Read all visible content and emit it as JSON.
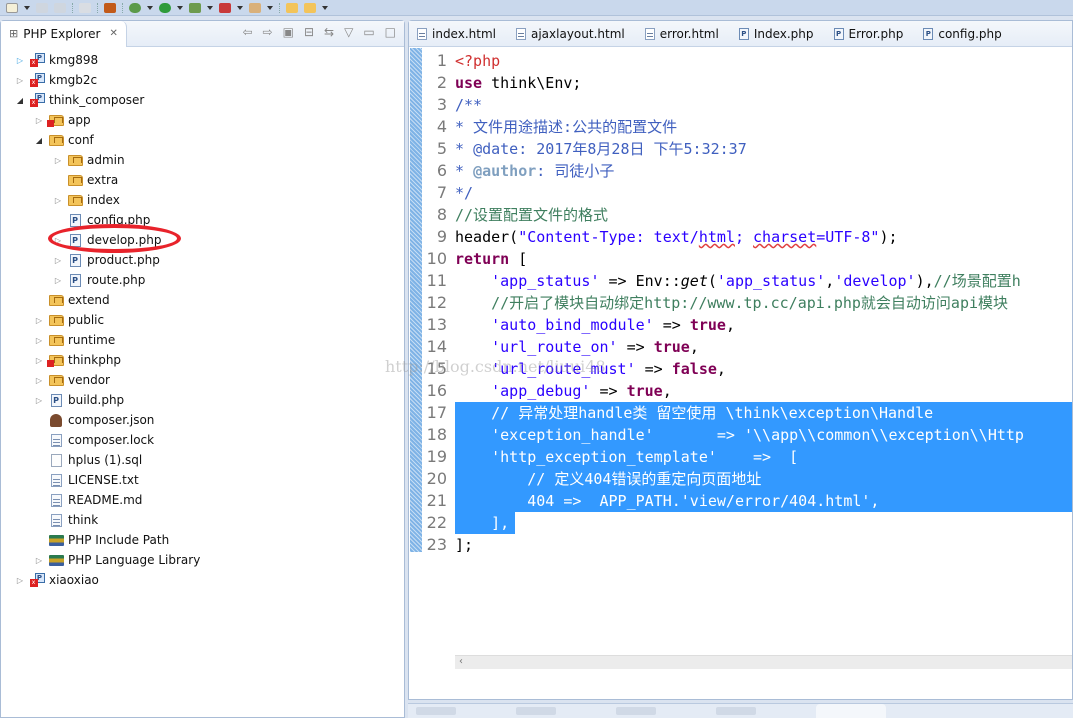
{
  "explorer": {
    "title": "PHP Explorer",
    "close_icon": "close-icon",
    "actions": [
      {
        "name": "back-icon",
        "glyph": "⇦"
      },
      {
        "name": "forward-icon",
        "glyph": "⇨"
      },
      {
        "name": "up-icon",
        "glyph": "▣"
      },
      {
        "name": "collapse-all-icon",
        "glyph": "⊟"
      },
      {
        "name": "link-with-editor-icon",
        "glyph": "⇆"
      },
      {
        "name": "view-menu-icon",
        "glyph": "▽"
      },
      {
        "name": "minimize-icon",
        "glyph": "▭"
      },
      {
        "name": "maximize-icon",
        "glyph": "□"
      }
    ],
    "tree": [
      {
        "label": "kmg898",
        "depth": 0,
        "icon": "project",
        "twisty": "collapsed-blue"
      },
      {
        "label": "kmgb2c",
        "depth": 0,
        "icon": "project",
        "twisty": "collapsed"
      },
      {
        "label": "think_composer",
        "depth": 0,
        "icon": "project",
        "twisty": "expanded"
      },
      {
        "label": "app",
        "depth": 1,
        "icon": "folder-error",
        "twisty": "collapsed"
      },
      {
        "label": "conf",
        "depth": 1,
        "icon": "folder",
        "twisty": "expanded"
      },
      {
        "label": "admin",
        "depth": 2,
        "icon": "folder",
        "twisty": "collapsed"
      },
      {
        "label": "extra",
        "depth": 2,
        "icon": "folder",
        "twisty": "none"
      },
      {
        "label": "index",
        "depth": 2,
        "icon": "folder",
        "twisty": "collapsed"
      },
      {
        "label": "config.php",
        "depth": 2,
        "icon": "php",
        "twisty": "none"
      },
      {
        "label": "develop.php",
        "depth": 2,
        "icon": "php",
        "twisty": "collapsed"
      },
      {
        "label": "product.php",
        "depth": 2,
        "icon": "php",
        "twisty": "collapsed"
      },
      {
        "label": "route.php",
        "depth": 2,
        "icon": "php",
        "twisty": "collapsed"
      },
      {
        "label": "extend",
        "depth": 1,
        "icon": "folder",
        "twisty": "none"
      },
      {
        "label": "public",
        "depth": 1,
        "icon": "folder",
        "twisty": "collapsed"
      },
      {
        "label": "runtime",
        "depth": 1,
        "icon": "folder",
        "twisty": "collapsed"
      },
      {
        "label": "thinkphp",
        "depth": 1,
        "icon": "folder-error",
        "twisty": "collapsed"
      },
      {
        "label": "vendor",
        "depth": 1,
        "icon": "folder",
        "twisty": "collapsed"
      },
      {
        "label": "build.php",
        "depth": 1,
        "icon": "php",
        "twisty": "collapsed"
      },
      {
        "label": "composer.json",
        "depth": 1,
        "icon": "composer",
        "twisty": "none"
      },
      {
        "label": "composer.lock",
        "depth": 1,
        "icon": "text",
        "twisty": "none"
      },
      {
        "label": "hplus (1).sql",
        "depth": 1,
        "icon": "blank",
        "twisty": "none"
      },
      {
        "label": "LICENSE.txt",
        "depth": 1,
        "icon": "text",
        "twisty": "none"
      },
      {
        "label": "README.md",
        "depth": 1,
        "icon": "text",
        "twisty": "none"
      },
      {
        "label": "think",
        "depth": 1,
        "icon": "text",
        "twisty": "none"
      },
      {
        "label": "PHP Include Path",
        "depth": 1,
        "icon": "library",
        "twisty": "none"
      },
      {
        "label": "PHP Language Library",
        "depth": 1,
        "icon": "library",
        "twisty": "collapsed"
      },
      {
        "label": "xiaoxiao",
        "depth": 0,
        "icon": "project",
        "twisty": "collapsed"
      }
    ],
    "highlighted_item": "config.php",
    "highlight_color": "#e8232b"
  },
  "editor": {
    "tabs": [
      {
        "label": "index.html",
        "icon": "html"
      },
      {
        "label": "ajaxlayout.html",
        "icon": "html"
      },
      {
        "label": "error.html",
        "icon": "html"
      },
      {
        "label": "Index.php",
        "icon": "php"
      },
      {
        "label": "Error.php",
        "icon": "php"
      },
      {
        "label": "config.php",
        "icon": "php"
      }
    ],
    "active_tab": "config.php",
    "selection_color": "#3399ff",
    "lines": [
      {
        "n": "1",
        "tokens": [
          {
            "t": "<?php",
            "c": "k-php"
          }
        ]
      },
      {
        "n": "2",
        "tokens": [
          {
            "t": "use",
            "c": "k-kw"
          },
          {
            "t": " think\\Env;",
            "c": ""
          }
        ]
      },
      {
        "n": "3",
        "tokens": [
          {
            "t": "/**",
            "c": "k-cmt"
          }
        ]
      },
      {
        "n": "4",
        "tokens": [
          {
            "t": "* 文件用途描述:公共的配置文件",
            "c": "k-cmt"
          }
        ]
      },
      {
        "n": "5",
        "tokens": [
          {
            "t": "* ",
            "c": "k-cmt"
          },
          {
            "t": "@date",
            "c": "k-cmt"
          },
          {
            "t": ": 2017年8月28日 下午5:32:37",
            "c": "k-cmt"
          }
        ]
      },
      {
        "n": "6",
        "tokens": [
          {
            "t": "* ",
            "c": "k-cmt"
          },
          {
            "t": "@author",
            "c": "k-cmt-tag"
          },
          {
            "t": ": 司徒小子",
            "c": "k-cmt"
          }
        ]
      },
      {
        "n": "7",
        "tokens": [
          {
            "t": "*/",
            "c": "k-cmt"
          }
        ]
      },
      {
        "n": "8",
        "tokens": [
          {
            "t": "//设置配置文件的格式",
            "c": "k-line-cmt"
          }
        ]
      },
      {
        "n": "9",
        "tokens": [
          {
            "t": "header(",
            "c": ""
          },
          {
            "t": "\"Content-Type: text/",
            "c": "k-str"
          },
          {
            "t": "html",
            "c": "k-str squiggle"
          },
          {
            "t": "; ",
            "c": "k-str"
          },
          {
            "t": "charset",
            "c": "k-str squiggle"
          },
          {
            "t": "=UTF-8\"",
            "c": "k-str"
          },
          {
            "t": ");",
            "c": ""
          }
        ]
      },
      {
        "n": "10",
        "tokens": [
          {
            "t": "return",
            "c": "k-kw"
          },
          {
            "t": " [",
            "c": ""
          }
        ]
      },
      {
        "n": "11",
        "tokens": [
          {
            "t": "    ",
            "c": ""
          },
          {
            "t": "'app_status'",
            "c": "k-str"
          },
          {
            "t": " => Env::",
            "c": ""
          },
          {
            "t": "get",
            "c": "k-fn"
          },
          {
            "t": "(",
            "c": ""
          },
          {
            "t": "'app_status'",
            "c": "k-str"
          },
          {
            "t": ",",
            "c": ""
          },
          {
            "t": "'develop'",
            "c": "k-str"
          },
          {
            "t": "),",
            "c": ""
          },
          {
            "t": "//场景配置h",
            "c": "k-line-cmt"
          }
        ]
      },
      {
        "n": "12",
        "tokens": [
          {
            "t": "    ",
            "c": ""
          },
          {
            "t": "//开启了模块自动绑定http://www.tp.cc/api.php就会自动访问api模块",
            "c": "k-line-cmt"
          }
        ]
      },
      {
        "n": "13",
        "tokens": [
          {
            "t": "    ",
            "c": ""
          },
          {
            "t": "'auto_bind_module'",
            "c": "k-str"
          },
          {
            "t": " => ",
            "c": ""
          },
          {
            "t": "true",
            "c": "k-kw"
          },
          {
            "t": ",",
            "c": ""
          }
        ]
      },
      {
        "n": "14",
        "tokens": [
          {
            "t": "    ",
            "c": ""
          },
          {
            "t": "'url_route_on'",
            "c": "k-str"
          },
          {
            "t": " => ",
            "c": ""
          },
          {
            "t": "true",
            "c": "k-kw"
          },
          {
            "t": ",",
            "c": ""
          }
        ]
      },
      {
        "n": "15",
        "tokens": [
          {
            "t": "    ",
            "c": ""
          },
          {
            "t": "'url_route_must'",
            "c": "k-str"
          },
          {
            "t": " => ",
            "c": ""
          },
          {
            "t": "false",
            "c": "k-kw"
          },
          {
            "t": ",",
            "c": ""
          }
        ]
      },
      {
        "n": "16",
        "tokens": [
          {
            "t": "    ",
            "c": ""
          },
          {
            "t": "'app_debug'",
            "c": "k-str"
          },
          {
            "t": " => ",
            "c": ""
          },
          {
            "t": "true",
            "c": "k-kw"
          },
          {
            "t": ",",
            "c": ""
          }
        ]
      },
      {
        "n": "17",
        "sel": "full",
        "tokens": [
          {
            "t": "    // 异常处理handle类 留空使用 \\think\\exception\\Handle",
            "c": ""
          }
        ]
      },
      {
        "n": "18",
        "sel": "full",
        "tokens": [
          {
            "t": "    'exception_handle'       => '\\\\app\\\\common\\\\exception\\\\Http",
            "c": ""
          }
        ]
      },
      {
        "n": "19",
        "sel": "full",
        "tokens": [
          {
            "t": "    'http_exception_template'    =>  [",
            "c": ""
          }
        ]
      },
      {
        "n": "20",
        "sel": "full",
        "tokens": [
          {
            "t": "        // 定义404错误的重定向页面地址",
            "c": ""
          }
        ]
      },
      {
        "n": "21",
        "sel": "full",
        "tokens": [
          {
            "t": "        404 =>  APP_PATH.'view/error/404.html',",
            "c": ""
          }
        ]
      },
      {
        "n": "22",
        "sel": "partial",
        "tokens": [
          {
            "t": "    ],",
            "c": ""
          }
        ]
      },
      {
        "n": "23",
        "tokens": [
          {
            "t": "];",
            "c": ""
          }
        ]
      }
    ]
  },
  "watermark": "http://blog.csdn.net/liuui48"
}
